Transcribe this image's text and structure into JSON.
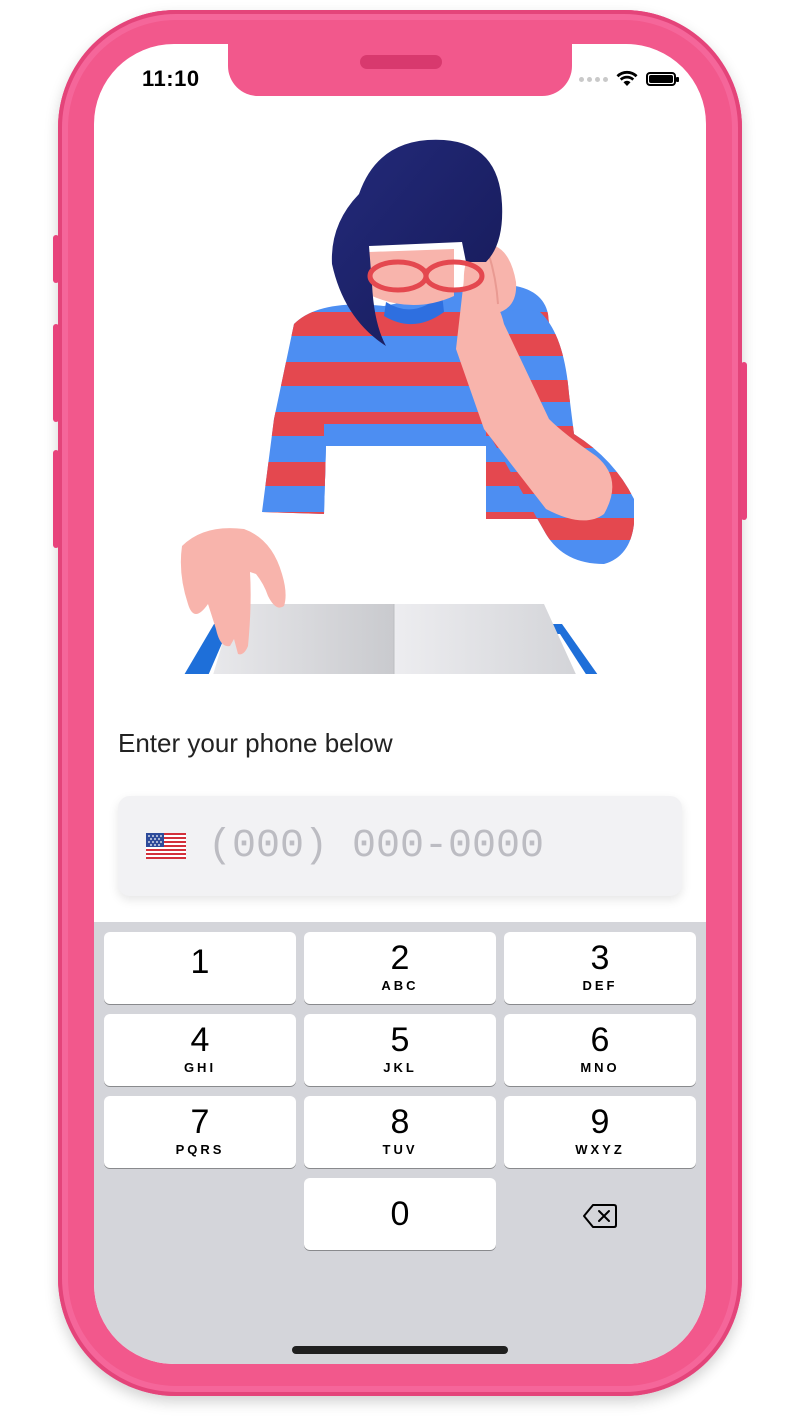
{
  "status_bar": {
    "time": "11:10"
  },
  "prompt": {
    "text": "Enter your phone below"
  },
  "phone_field": {
    "placeholder": "(000) 000-0000",
    "value": "",
    "country_flag": "us-flag-icon"
  },
  "keypad": {
    "keys": [
      {
        "digit": "1",
        "letters": ""
      },
      {
        "digit": "2",
        "letters": "ABC"
      },
      {
        "digit": "3",
        "letters": "DEF"
      },
      {
        "digit": "4",
        "letters": "GHI"
      },
      {
        "digit": "5",
        "letters": "JKL"
      },
      {
        "digit": "6",
        "letters": "MNO"
      },
      {
        "digit": "7",
        "letters": "PQRS"
      },
      {
        "digit": "8",
        "letters": "TUV"
      },
      {
        "digit": "9",
        "letters": "WXYZ"
      },
      {
        "digit": "0",
        "letters": ""
      }
    ],
    "delete_icon": "backspace-icon"
  },
  "colors": {
    "device_frame": "#f2588c",
    "keyboard_bg": "#d4d5da",
    "stripe_red": "#e4484f",
    "stripe_blue": "#4d8ef2",
    "hair": "#1b1f66",
    "skin": "#f8b4ac",
    "tray_blue": "#1e6fd9"
  }
}
